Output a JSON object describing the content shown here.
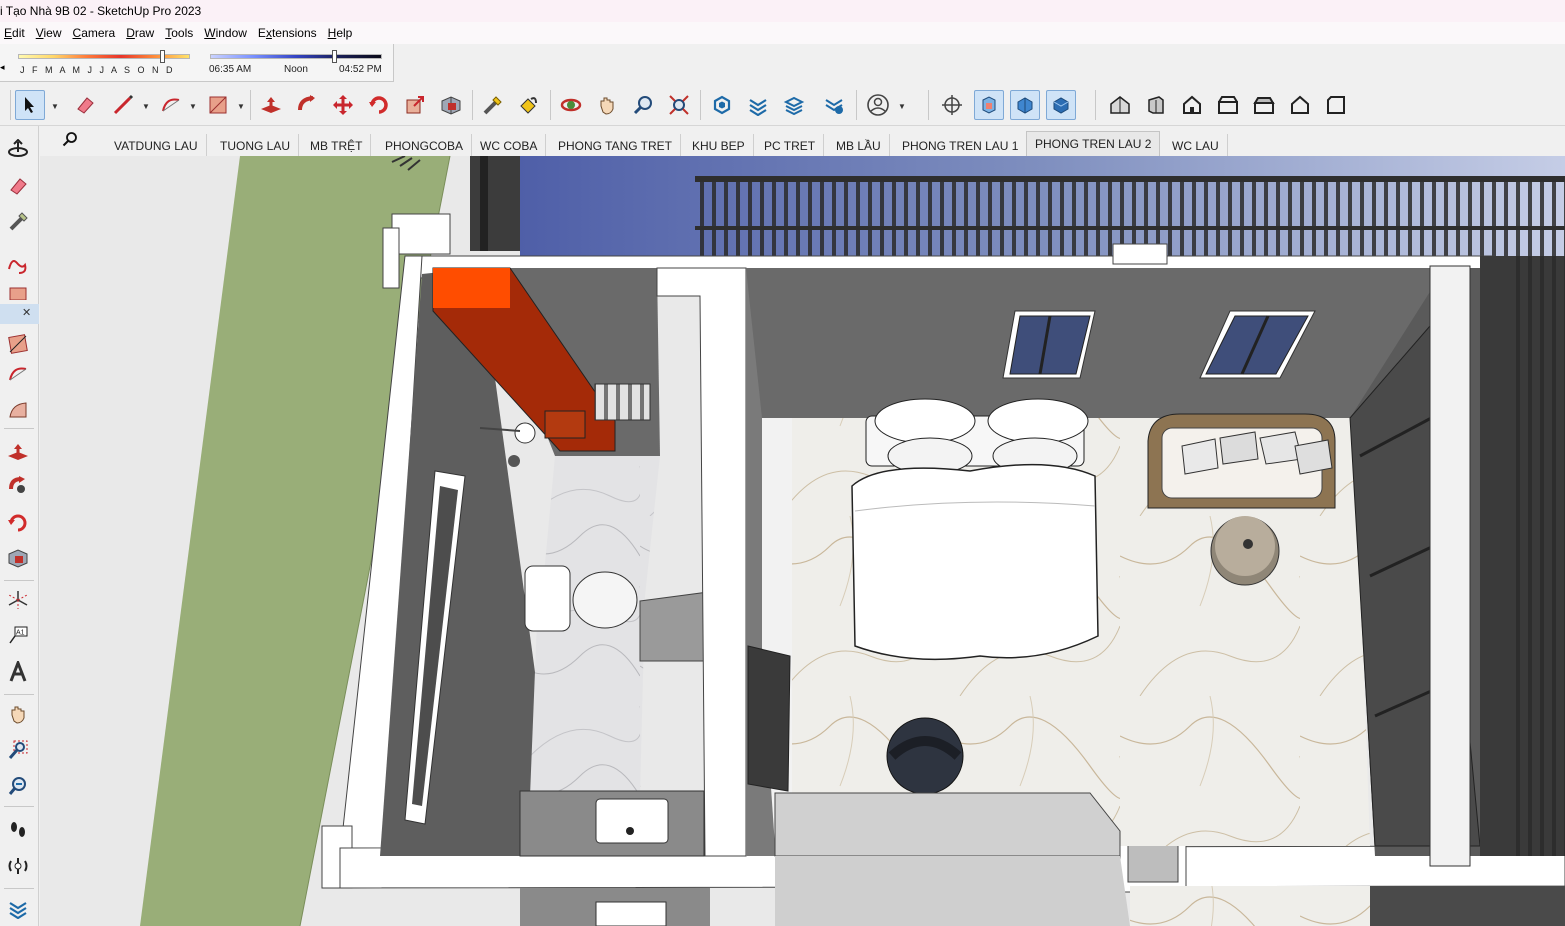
{
  "window": {
    "title": "i Tạo Nhà 9B 02 - SketchUp Pro 2023"
  },
  "menu": [
    {
      "label": "Edit",
      "key": "E",
      "rest": "dit"
    },
    {
      "label": "View",
      "key": "V",
      "rest": "iew"
    },
    {
      "label": "Camera",
      "key": "C",
      "rest": "amera"
    },
    {
      "label": "Draw",
      "key": "D",
      "rest": "raw"
    },
    {
      "label": "Tools",
      "key": "T",
      "rest": "ools"
    },
    {
      "label": "Window",
      "key": "W",
      "rest": "indow"
    },
    {
      "label": "Extensions",
      "key": "x",
      "pre": "E",
      "rest": "tensions"
    },
    {
      "label": "Help",
      "key": "H",
      "rest": "elp"
    }
  ],
  "shadows": {
    "months": "J F M A M J J A S O N D",
    "time_start": "06:35 AM",
    "time_mid": "Noon",
    "time_end": "04:52 PM",
    "month_value": 0.84,
    "time_value": 0.72
  },
  "toolbar_icons": [
    "select-icon",
    "eraser-icon",
    "line-icon",
    "arc-icon",
    "rectangle-icon",
    "push-pull-icon",
    "follow-me-icon",
    "move-icon",
    "rotate-icon",
    "scale-icon",
    "offset-icon",
    "tape-measure-icon",
    "paint-bucket-icon",
    "orbit-icon",
    "pan-icon",
    "zoom-icon",
    "zoom-extents-icon",
    "warehouse-icon",
    "extension-warehouse-icon",
    "layout-icon",
    "extension-manager-icon",
    "user-icon",
    "section-plane-icon",
    "display-section-planes-icon",
    "display-section-cuts-icon",
    "display-section-fill-icon",
    "iso-view-icon",
    "top-view-icon",
    "front-view-icon",
    "right-view-icon",
    "back-view-icon",
    "left-view-icon",
    "bottom-view-icon"
  ],
  "scene_tabs": [
    "VATDUNG LAU",
    "TUONG LAU",
    "MB TRỆT",
    "PHONGCOBA",
    "WC COBA",
    "PHONG TANG TRET",
    "KHU BEP",
    "PC TRET",
    "MB LẦU",
    "PHONG TREN LAU 1",
    "PHONG TREN LAU 2",
    "WC LAU"
  ],
  "active_scene": "PHONG TREN LAU 2",
  "left_tools": [
    "orbit-icon",
    "eraser-icon",
    "tape-measure-icon",
    "freehand-icon",
    "rectangle-icon",
    "arc-icon",
    "pie-icon",
    "push-pull-icon",
    "follow-me-icon",
    "rotate-icon",
    "offset-icon",
    "axes-icon",
    "text-icon",
    "3d-text-icon",
    "pan-icon",
    "zoom-window-icon",
    "zoom-previous-icon",
    "footprints-icon",
    "look-around-icon",
    "layers-icon"
  ],
  "colors": {
    "grass": "#99ae78",
    "wall_top": "#ffffff",
    "wall_dark": "#6a6a6a",
    "cabinet": "#c93a06",
    "marble": "#efeeea"
  }
}
